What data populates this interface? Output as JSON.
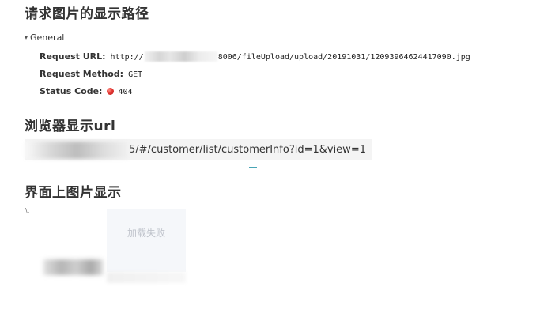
{
  "sections": {
    "request_path_title": "请求图片的显示路径",
    "browser_title": "浏览器显示url",
    "ui_title": "界面上图片显示"
  },
  "general": {
    "header_label": "General",
    "triangle_icon": "▾",
    "request_url_key": "Request URL:",
    "request_url_prefix": "http://",
    "request_url_suffix": "8006/fileUpload/upload/20191031/12093964624417090.jpg",
    "request_method_key": "Request Method:",
    "request_method_value": "GET",
    "status_code_key": "Status Code:",
    "status_code_value": "404",
    "status_color": "#e53935"
  },
  "browser": {
    "url_visible_text": "5/#/customer/list/customerInfo?id=1&view=1"
  },
  "image_area": {
    "tiny_glyph": "\\.",
    "placeholder_text": "加载失败"
  }
}
